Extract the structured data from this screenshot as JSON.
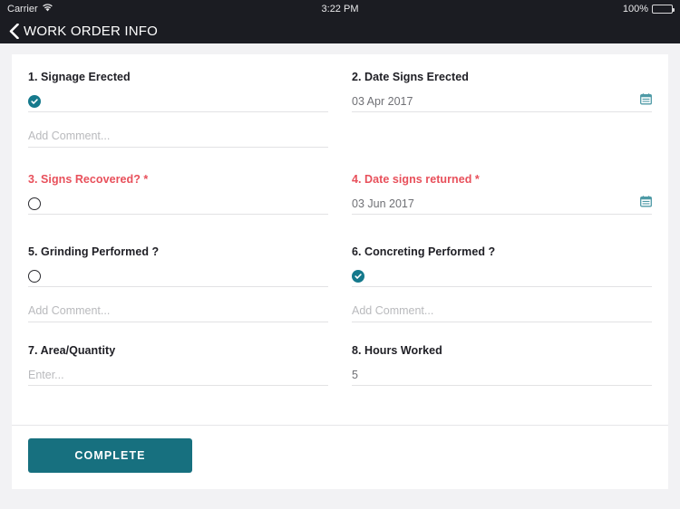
{
  "status_bar": {
    "carrier": "Carrier",
    "wifi_icon": "wifi-icon",
    "time": "3:22 PM",
    "battery_percent": "100%",
    "battery_icon": "battery-icon"
  },
  "nav": {
    "back_icon": "chevron-left-icon",
    "title": "WORK ORDER INFO"
  },
  "form": {
    "fields": [
      {
        "label": "1. Signage Erected",
        "control": "checkbox",
        "checked": true,
        "required": false,
        "comment_placeholder": "Add Comment..."
      },
      {
        "label": "2. Date Signs Erected",
        "control": "date",
        "value": "03 Apr 2017",
        "required": false,
        "icon": "calendar-icon"
      },
      {
        "label": "3. Signs Recovered? *",
        "control": "checkbox",
        "checked": false,
        "required": true
      },
      {
        "label": "4. Date signs returned *",
        "control": "date",
        "value": "03 Jun 2017",
        "required": true,
        "icon": "calendar-icon"
      },
      {
        "label": "5. Grinding Performed ?",
        "control": "checkbox",
        "checked": false,
        "required": false,
        "comment_placeholder": "Add Comment..."
      },
      {
        "label": "6. Concreting Performed ?",
        "control": "checkbox",
        "checked": true,
        "required": false,
        "comment_placeholder": "Add Comment..."
      },
      {
        "label": "7. Area/Quantity",
        "control": "text",
        "value": "",
        "placeholder": "Enter...",
        "required": false
      },
      {
        "label": "8. Hours Worked",
        "control": "text",
        "value": "5",
        "placeholder": "",
        "required": false
      }
    ]
  },
  "footer": {
    "complete_label": "COMPLETE"
  },
  "colors": {
    "accent_teal": "#15798c",
    "button_teal": "#17707f",
    "required_red": "#e8505b",
    "nav_bar": "#1b1c22",
    "page_bg": "#f2f2f4"
  }
}
